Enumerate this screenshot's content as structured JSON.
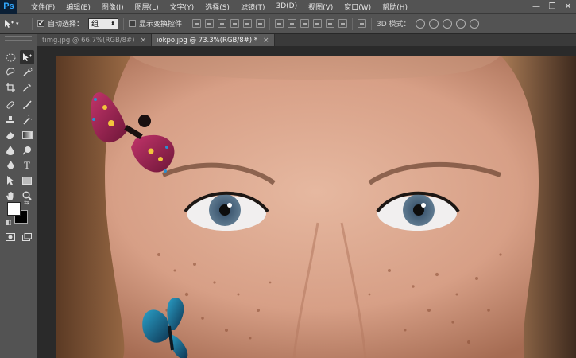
{
  "app": {
    "logo": "Ps"
  },
  "menu": {
    "items": [
      "文件(F)",
      "编辑(E)",
      "图像(I)",
      "图层(L)",
      "文字(Y)",
      "选择(S)",
      "滤镜(T)",
      "3D(D)",
      "视图(V)",
      "窗口(W)",
      "帮助(H)"
    ]
  },
  "window_controls": {
    "minimize": "—",
    "maximize": "❐",
    "close": "✕"
  },
  "options": {
    "auto_select_label": "自动选择：",
    "auto_select_checked": "✔",
    "auto_select_value": "组",
    "show_transform_label": "显示变换控件",
    "mode_3d_label": "3D 模式："
  },
  "tabs": [
    {
      "label": "timg.jpg @ 66.7%(RGB/8#)",
      "close": "×"
    },
    {
      "label": "iokpo.jpg @ 73.3%(RGB/8#) *",
      "close": "×"
    }
  ],
  "colors": {
    "foreground": "#ffffff",
    "background": "#000000",
    "chrome": "#535353",
    "logo_bg": "#0b1f35",
    "logo_fg": "#31a8ff"
  }
}
